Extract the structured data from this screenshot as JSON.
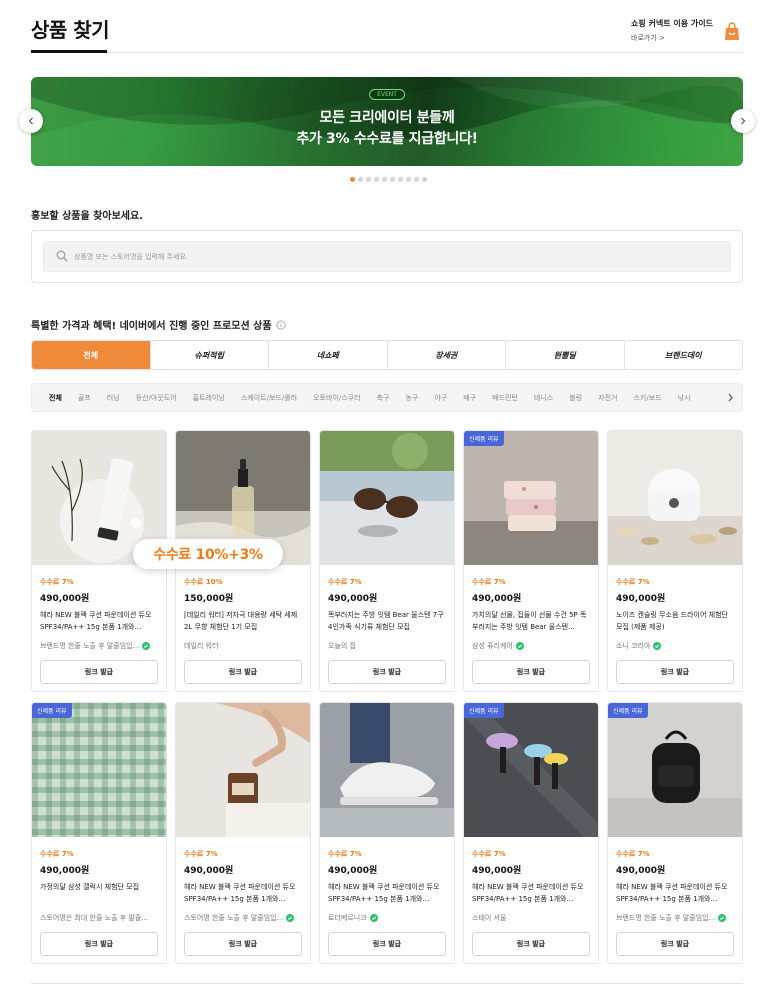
{
  "header": {
    "title": "상품 찾기",
    "guide_title": "쇼핑 커넥트 이용 가이드",
    "guide_link": "바로가기 >"
  },
  "banner": {
    "badge": "EVENT",
    "line1": "모든 크리에이터 분들께",
    "line2": "추가 3% 수수료를 지급합니다!",
    "active_dot": 0,
    "dot_count": 10,
    "colors": {
      "primary": "#2f8f3a",
      "dark": "#123a18"
    }
  },
  "search": {
    "heading": "홍보할 상품을 찾아보세요.",
    "placeholder": "상품명 또는 스토어명을 입력해 주세요.",
    "value": ""
  },
  "promo": {
    "heading": "특별한 가격과 혜택! 네이버에서 진행 중인 프로모션 상품",
    "tabs": [
      "전체",
      "슈퍼적립",
      "네쇼페",
      "장세권",
      "원쁠딜",
      "브랜드데이"
    ],
    "active_tab": 0,
    "accent": "#ef8a3b"
  },
  "categories": {
    "items": [
      "전체",
      "골프",
      "러닝",
      "등산/아웃도어",
      "홈트레이닝",
      "스케이트/보드/롤러",
      "오토바이/스쿠터",
      "축구",
      "농구",
      "야구",
      "배구",
      "배드민턴",
      "테니스",
      "볼링",
      "자전거",
      "스키/보드",
      "낚시"
    ],
    "active": 0
  },
  "tooltip": "수수료 10%+3%",
  "products": [
    {
      "badge": "",
      "commission": "수수료 7%",
      "price": "490,000원",
      "desc": "헤라 NEW 블랙 쿠션 파운데이션 듀오 SPF34/PA++ 15g 본품 1개와...",
      "shop": "브랜드명 한줄 노출 후 말줄임입...",
      "verified": true,
      "button": "링크 발급",
      "image": "cosmetic-tube"
    },
    {
      "badge": "",
      "commission": "수수료 10%",
      "price": "150,000원",
      "desc": "[데일리 워터] 저자극 대용량 세탁 세제 2L 무향 체험단 1기 모집",
      "shop": "데일리 워터",
      "verified": false,
      "button": "링크 발급",
      "image": "serum-bottle"
    },
    {
      "badge": "",
      "commission": "수수료 7%",
      "price": "490,000원",
      "desc": "똑부러지는 주방 잇템 Bear 울스텐 7구 4인가족 식기류 체험단 모집",
      "shop": "오늘의 집",
      "verified": false,
      "button": "링크 발급",
      "image": "sunglasses"
    },
    {
      "badge": "신제품 리뷰",
      "commission": "수수료 7%",
      "price": "490,000원",
      "desc": "가치의달 선물, 집들이 선물 수건 5P 똑부러지는 주방 잇템 Bear 울스텐...",
      "shop": "삼성 퓨리케어",
      "verified": true,
      "button": "링크 발급",
      "image": "soap-bars"
    },
    {
      "badge": "",
      "commission": "수수료 7%",
      "price": "490,000원",
      "desc": "노이즈 캔슬링 무소음 드라이어 체험단 모집 (제품 제공)",
      "shop": "소니 코리아",
      "verified": true,
      "button": "링크 발급",
      "image": "rice-cooker"
    },
    {
      "badge": "신제품 리뷰",
      "commission": "수수료 7%",
      "price": "490,000원",
      "desc": "가정의달 삼성 갤럭시 체험단 모집",
      "shop": "스토어명은 최대 한줄 노출 후 말줄...",
      "verified": false,
      "button": "링크 발급",
      "image": "green-fabric"
    },
    {
      "badge": "",
      "commission": "수수료 7%",
      "price": "490,000원",
      "desc": "헤라 NEW 블랙 쿠션 파운데이션 듀오 SPF34/PA++ 15g 본품 1개와...",
      "shop": "스토어명 한줄 노출 후 말줄임입...",
      "verified": true,
      "button": "링크 발급",
      "image": "candle"
    },
    {
      "badge": "",
      "commission": "수수료 7%",
      "price": "490,000원",
      "desc": "헤라 NEW 블랙 쿠션 파운데이션 듀오 SPF34/PA++ 15g 본품 1개와...",
      "shop": "로더베르니크",
      "verified": true,
      "button": "링크 발급",
      "image": "sneakers"
    },
    {
      "badge": "신제품 리뷰",
      "commission": "수수료 7%",
      "price": "490,000원",
      "desc": "헤라 NEW 블랙 쿠션 파운데이션 듀오 SPF34/PA++ 15g 본품 1개와...",
      "shop": "스테이 서울",
      "verified": false,
      "button": "링크 발급",
      "image": "umbrellas"
    },
    {
      "badge": "신제품 리뷰",
      "commission": "수수료 7%",
      "price": "490,000원",
      "desc": "헤라 NEW 블랙 쿠션 파운데이션 듀오 SPF34/PA++ 15g 본품 1개와...",
      "shop": "브랜드명 한줄 노출 후 말줄임입...",
      "verified": true,
      "button": "링크 발급",
      "image": "black-backpack"
    }
  ]
}
